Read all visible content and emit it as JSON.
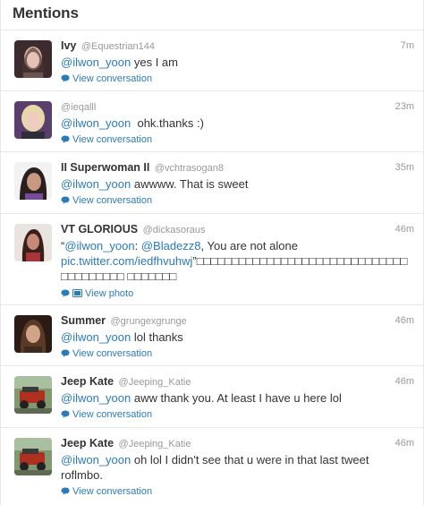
{
  "header": {
    "title": "Mentions"
  },
  "tweets": [
    {
      "fullname": "Ivy",
      "username": "@Equestrian144",
      "time": "7m",
      "mention": "@ilwon_yoon",
      "text": " yes I am",
      "action": "View conversation",
      "avatar_icon": "avatar-photo"
    },
    {
      "fullname": "",
      "username": "@ieqalll",
      "time": "23m",
      "mention": "@ilwon_yoon",
      "text": "  ohk.thanks :)",
      "action": "View conversation",
      "avatar_icon": "avatar-photo"
    },
    {
      "fullname": "II Superwoman II",
      "username": "@vchtrasogan8",
      "time": "35m",
      "mention": "@ilwon_yoon",
      "text": " awwww. That is sweet",
      "action": "View conversation",
      "avatar_icon": "avatar-photo"
    },
    {
      "fullname": "VT GLORIOUS",
      "username": "@dickasoraus",
      "time": "46m",
      "text_parts": {
        "open_quote": "“",
        "mention1": "@ilwon_yoon",
        "sep": ": ",
        "mention2": "@Bladezz8",
        "rest": ", You are not alone",
        "link": "pic.twitter.com/iedfhvuhwj",
        "tail": "”□□□□□□□□□□□□□□□□□□□□□□□□□□□□□□□□□□□□□□□ □□□□□□□"
      },
      "action": "View photo",
      "avatar_icon": "avatar-photo"
    },
    {
      "fullname": "Summer",
      "username": "@grungexgrunge",
      "time": "46m",
      "mention": "@ilwon_yoon",
      "text": " lol thanks",
      "action": "View conversation",
      "avatar_icon": "avatar-photo"
    },
    {
      "fullname": "Jeep Kate",
      "username": "@Jeeping_Katie",
      "time": "46m",
      "mention": "@ilwon_yoon",
      "text": " aww thank you. At least I have u here lol",
      "action": "View conversation",
      "avatar_icon": "jeep-photo"
    },
    {
      "fullname": "Jeep Kate",
      "username": "@Jeeping_Katie",
      "time": "46m",
      "mention": "@ilwon_yoon",
      "text": " oh lol I didn't see that u were in that last tweet roflmbo.",
      "action": "View conversation",
      "avatar_icon": "jeep-photo"
    }
  ],
  "colors": {
    "link": "#2b7bb9",
    "muted": "#999999",
    "text": "#333333",
    "divider": "#e8e8e8"
  }
}
